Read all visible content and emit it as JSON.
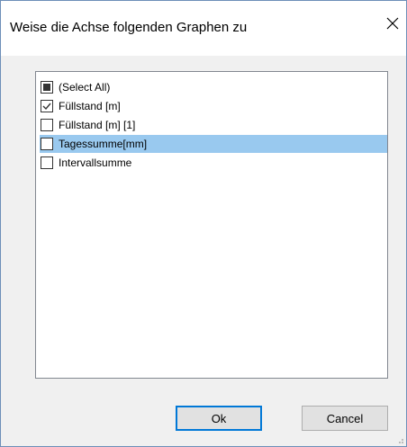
{
  "dialog": {
    "title": "Weise die Achse folgenden Graphen zu",
    "close_icon": "close-icon"
  },
  "list": {
    "items": [
      {
        "label": "(Select All)",
        "state": "indeterminate",
        "selected": false
      },
      {
        "label": "Füllstand [m]",
        "state": "checked",
        "selected": false
      },
      {
        "label": "Füllstand [m] [1]",
        "state": "unchecked",
        "selected": false
      },
      {
        "label": "Tagessumme[mm]",
        "state": "unchecked",
        "selected": true
      },
      {
        "label": "Intervallsumme",
        "state": "unchecked",
        "selected": false
      }
    ]
  },
  "buttons": {
    "ok_label": "Ok",
    "cancel_label": "Cancel"
  },
  "colors": {
    "selection": "#99c9ef",
    "default_button_border": "#0078d7",
    "window_border": "#6d8fb8"
  }
}
